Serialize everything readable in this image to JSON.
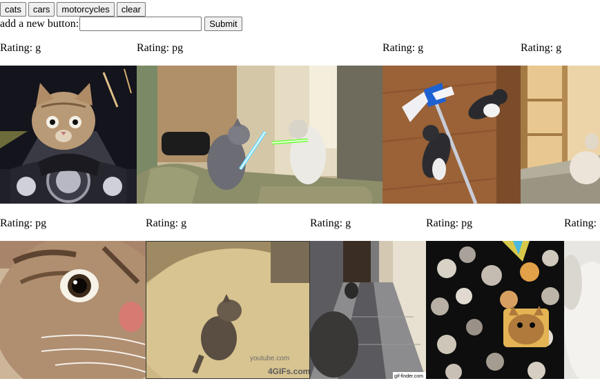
{
  "toolbar": {
    "buttons": [
      "cats",
      "cars",
      "motorcycles",
      "clear"
    ],
    "add_label": "add a new button:",
    "input_value": "",
    "submit_label": "Submit"
  },
  "gifs": [
    {
      "rating": "Rating: g",
      "content": "kitten riding motorcycle"
    },
    {
      "rating": "Rating: pg",
      "content": "two cats fighting with lightsabers"
    },
    {
      "rating": "Rating: g",
      "content": "kittens playing with a mop"
    },
    {
      "rating": "Rating: g",
      "content": "cat on floor near wooden door"
    },
    {
      "rating": "Rating: pg",
      "content": "wide-eyed tabby cat close-up"
    },
    {
      "rating": "Rating: g",
      "content": "cat jumping on a round rug"
    },
    {
      "rating": "Rating: g",
      "content": "cats in a marble hallway"
    },
    {
      "rating": "Rating: pg",
      "content": "floating cat heads on black background"
    },
    {
      "rating": "Rating: g",
      "content": "white blurred cat"
    }
  ],
  "watermarks": {
    "gif_finder": "gif-finder.com",
    "gifs_com": "4GIFs.com",
    "youtube": "youtube.com"
  }
}
